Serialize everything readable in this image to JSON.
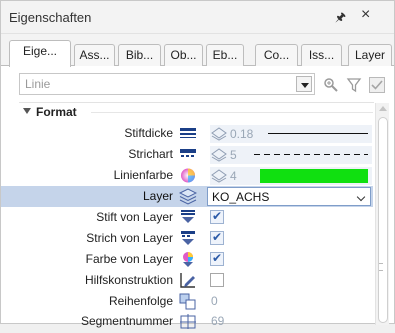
{
  "window": {
    "title": "Eigenschaften",
    "pin_glyph": "ᵖ",
    "close_glyph": "×"
  },
  "tabs": [
    "Eige...",
    "Ass...",
    "Bib...",
    "Ob...",
    "Eb...",
    "Co...",
    "Iss...",
    "Layer"
  ],
  "filter": {
    "value": "Linie"
  },
  "group": {
    "title": "Format"
  },
  "rows": [
    {
      "label": "Stiftdicke",
      "value": "0.18"
    },
    {
      "label": "Strichart",
      "value": "5"
    },
    {
      "label": "Linienfarbe",
      "value": "4",
      "color": "#10e010"
    },
    {
      "label": "Layer",
      "value": "KO_ACHS"
    },
    {
      "label": "Stift von Layer"
    },
    {
      "label": "Strich von Layer"
    },
    {
      "label": "Farbe von Layer"
    },
    {
      "label": "Hilfskonstruktion"
    },
    {
      "label": "Reihenfolge",
      "value": "0"
    },
    {
      "label": "Segmentnummer",
      "value": "69"
    }
  ],
  "colors": {
    "selection": "#c5d4ea",
    "accent": "#2b5aa8"
  }
}
